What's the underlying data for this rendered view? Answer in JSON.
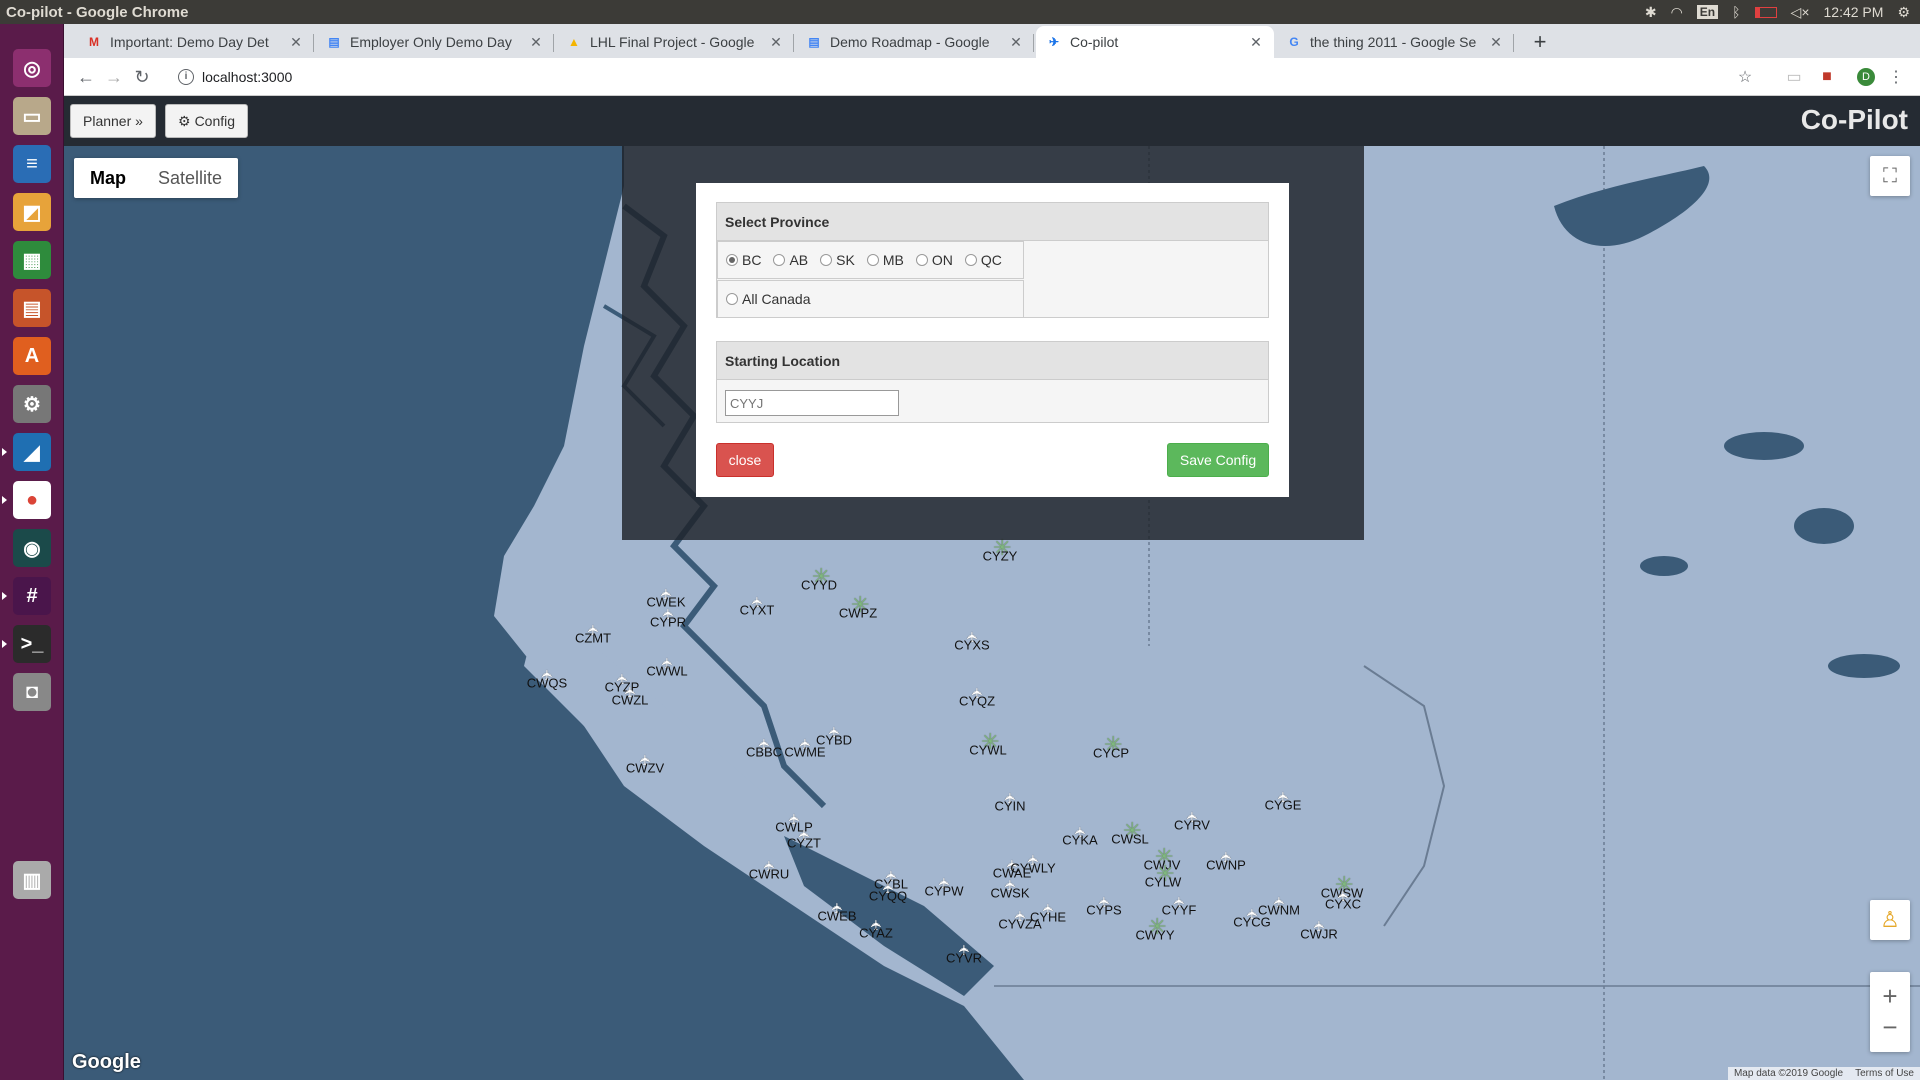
{
  "system": {
    "window_title": "Co-pilot - Google Chrome",
    "keyboard_layout": "En",
    "time": "12:42 PM"
  },
  "launcher": {
    "items": [
      {
        "name": "ubuntu-dash-icon",
        "color": "#8c2f6f",
        "glyph": "◎"
      },
      {
        "name": "files-icon",
        "color": "#b8a88a",
        "glyph": "▭"
      },
      {
        "name": "writer-icon",
        "color": "#2a6db5",
        "glyph": "≡"
      },
      {
        "name": "impress-draw-icon",
        "color": "#e7a33a",
        "glyph": "◩"
      },
      {
        "name": "calc-icon",
        "color": "#2e8b3c",
        "glyph": "▦"
      },
      {
        "name": "impress-icon",
        "color": "#c6542a",
        "glyph": "▤"
      },
      {
        "name": "software-center-icon",
        "color": "#e05f1f",
        "glyph": "A"
      },
      {
        "name": "system-settings-icon",
        "color": "#777777",
        "glyph": "⚙"
      },
      {
        "name": "vscode-icon",
        "color": "#1f6fb2",
        "glyph": "◢"
      },
      {
        "name": "chrome-icon",
        "color": "#ffffff",
        "glyph": "●"
      },
      {
        "name": "gitkraken-icon",
        "color": "#1b4a4a",
        "glyph": "◉"
      },
      {
        "name": "slack-icon",
        "color": "#4a154b",
        "glyph": "#"
      },
      {
        "name": "terminal-icon",
        "color": "#2b2b2b",
        "glyph": ">_"
      },
      {
        "name": "screenshot-icon",
        "color": "#888888",
        "glyph": "◘"
      },
      {
        "name": "trash-icon",
        "color": "#aaaaaa",
        "glyph": "▥"
      }
    ]
  },
  "chrome": {
    "tabs": [
      {
        "label": "Important: Demo Day Det",
        "icon": "gmail-icon",
        "active": false
      },
      {
        "label": "Employer Only Demo Day",
        "icon": "docs-icon",
        "active": false
      },
      {
        "label": "LHL Final Project - Google",
        "icon": "drive-icon",
        "active": false
      },
      {
        "label": "Demo Roadmap - Google",
        "icon": "docs-icon",
        "active": false
      },
      {
        "label": "Co-pilot",
        "icon": "plane-icon",
        "active": true
      },
      {
        "label": "the thing 2011 - Google Se",
        "icon": "google-icon",
        "active": false
      }
    ],
    "url": "localhost:3000",
    "profile_initial": "D"
  },
  "app": {
    "planner_label": "Planner »",
    "config_label": "Config",
    "brand": "Co-Pilot"
  },
  "map": {
    "map_label": "Map",
    "satellite_label": "Satellite",
    "google_label": "Google",
    "attribution": "Map data ©2019 Google",
    "terms": "Terms of Use",
    "airports": [
      {
        "code": "CYYD",
        "hub": true
      },
      {
        "code": "CYZY",
        "hub": true
      },
      {
        "code": "CWEK"
      },
      {
        "code": "CYXT"
      },
      {
        "code": "CWPZ",
        "hub": true
      },
      {
        "code": "CYPR"
      },
      {
        "code": "CZMT"
      },
      {
        "code": "CYXS"
      },
      {
        "code": "CWWL"
      },
      {
        "code": "CWQS"
      },
      {
        "code": "CYZP"
      },
      {
        "code": "CWZL"
      },
      {
        "code": "CYQZ"
      },
      {
        "code": "CYBD"
      },
      {
        "code": "CBBC"
      },
      {
        "code": "CWME"
      },
      {
        "code": "CYWL",
        "hub": true
      },
      {
        "code": "CYCP",
        "hub": true
      },
      {
        "code": "CWZV"
      },
      {
        "code": "CYIN"
      },
      {
        "code": "CYGE"
      },
      {
        "code": "CWLP"
      },
      {
        "code": "CYKA"
      },
      {
        "code": "CWSL",
        "hub": true
      },
      {
        "code": "CYRV"
      },
      {
        "code": "CYZT"
      },
      {
        "code": "CWJV",
        "hub": true
      },
      {
        "code": "CWNP"
      },
      {
        "code": "CWRU"
      },
      {
        "code": "CWAE"
      },
      {
        "code": "CYWLY"
      },
      {
        "code": "CYLW",
        "hub": true
      },
      {
        "code": "CYBL"
      },
      {
        "code": "CWSK"
      },
      {
        "code": "CYPW"
      },
      {
        "code": "CWSW",
        "hub": true
      },
      {
        "code": "CYQQ"
      },
      {
        "code": "CYXC"
      },
      {
        "code": "CWNM"
      },
      {
        "code": "CYCG"
      },
      {
        "code": "CWEB"
      },
      {
        "code": "CYAZ"
      },
      {
        "code": "CYYF"
      },
      {
        "code": "CYVR"
      },
      {
        "code": "CWJR"
      },
      {
        "code": "CWYY",
        "hub": true
      },
      {
        "code": "CYHE"
      },
      {
        "code": "CYVZA"
      },
      {
        "code": "CYPS"
      }
    ]
  },
  "modal": {
    "province_header": "Select Province",
    "provinces": [
      "BC",
      "AB",
      "SK",
      "MB",
      "ON",
      "QC"
    ],
    "selected_province": "BC",
    "all_canada_label": "All Canada",
    "location_header": "Starting Location",
    "location_placeholder": "CYYJ",
    "location_value": "",
    "close_label": "close",
    "save_label": "Save Config"
  }
}
